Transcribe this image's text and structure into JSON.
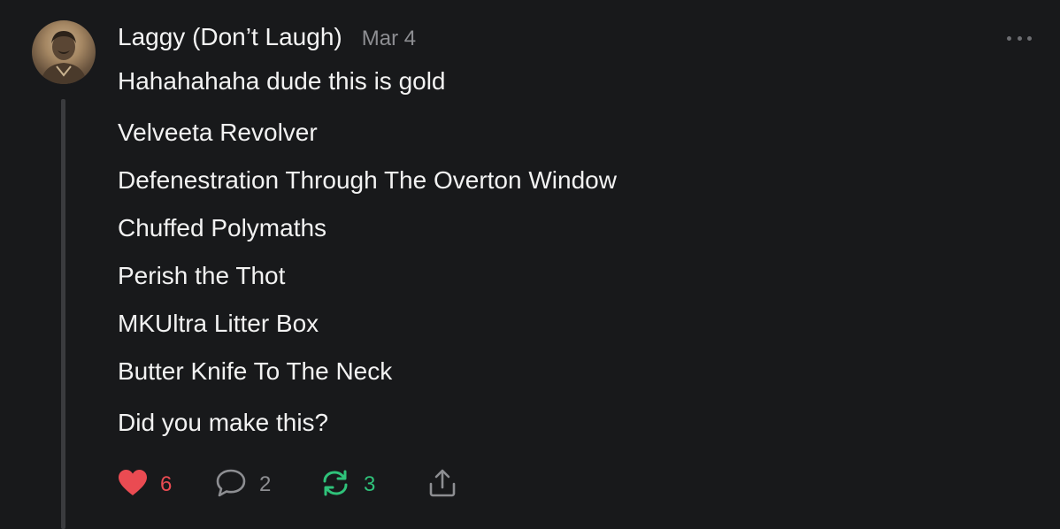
{
  "comment": {
    "author": "Laggy (Don’t Laugh)",
    "date": "Mar 4",
    "lines": [
      "Hahahahaha dude this is gold",
      "Velveeta Revolver",
      "Defenestration Through The Overton Window",
      "Chuffed Polymaths",
      "Perish the Thot",
      "MKUltra Litter Box",
      "Butter Knife To The Neck",
      "Did you make this?"
    ]
  },
  "actions": {
    "likes": "6",
    "comments": "2",
    "restacks": "3"
  },
  "colors": {
    "background": "#18191b",
    "like": "#ea4b52",
    "restack": "#2fc27a",
    "muted": "#8d8e92"
  },
  "icons": [
    "avatar",
    "heart-icon",
    "comment-bubble-icon",
    "restack-icon",
    "share-icon",
    "more-options-icon"
  ]
}
